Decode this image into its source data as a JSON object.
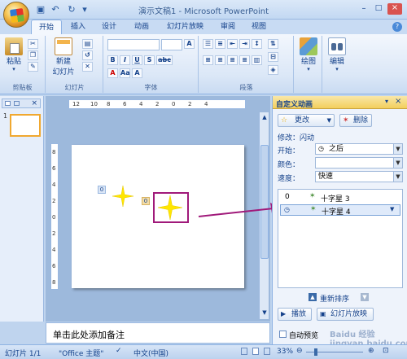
{
  "window": {
    "title": "演示文稿1 - Microsoft PowerPoint"
  },
  "tabs": [
    "开始",
    "插入",
    "设计",
    "动画",
    "幻灯片放映",
    "审阅",
    "视图"
  ],
  "ribbon": {
    "paste_label": "粘贴",
    "new_slide_label": "新建",
    "new_slide_label2": "幻灯片",
    "draw_label": "绘图",
    "edit_label": "编辑",
    "groups": {
      "clipboard": "剪贴板",
      "slides": "幻灯片",
      "font": "字体",
      "paragraph": "段落"
    },
    "font_buttons": [
      "B",
      "I",
      "U",
      "S",
      "abc",
      "A"
    ]
  },
  "ruler": {
    "ticks": [
      "12",
      "10",
      "8",
      "6",
      "4",
      "2",
      "0",
      "2",
      "4"
    ],
    "vticks": [
      "8",
      "6",
      "4",
      "2",
      "0",
      "2",
      "4",
      "6",
      "8"
    ]
  },
  "slide": {
    "label_1": "0",
    "label_2": "0"
  },
  "notes": {
    "placeholder": "单击此处添加备注"
  },
  "task_pane": {
    "title": "自定义动画",
    "change_btn": "更改",
    "delete_btn": "删除",
    "modify_label": "修改：闪动",
    "start_label": "开始：",
    "start_value": "之后",
    "color_label": "颜色：",
    "speed_label": "速度：",
    "speed_value": "快速",
    "items": [
      {
        "num": "0",
        "name": "十字星 3"
      },
      {
        "num": "",
        "name": "十字星 4"
      }
    ],
    "reorder_label": "重新排序",
    "play_label": "播放",
    "slideshow_label": "幻灯片放映",
    "autopreview_label": "自动预览"
  },
  "status": {
    "slide_info": "幻灯片 1/1",
    "theme": "\"Office 主题\"",
    "language": "中文(中国)",
    "zoom": "33%"
  },
  "colors": {
    "star": "#ffe600",
    "highlight_box": "#a0197a",
    "arrow": "#a0197a"
  },
  "watermark": "Baidu 经验 jingyan.baidu.com"
}
